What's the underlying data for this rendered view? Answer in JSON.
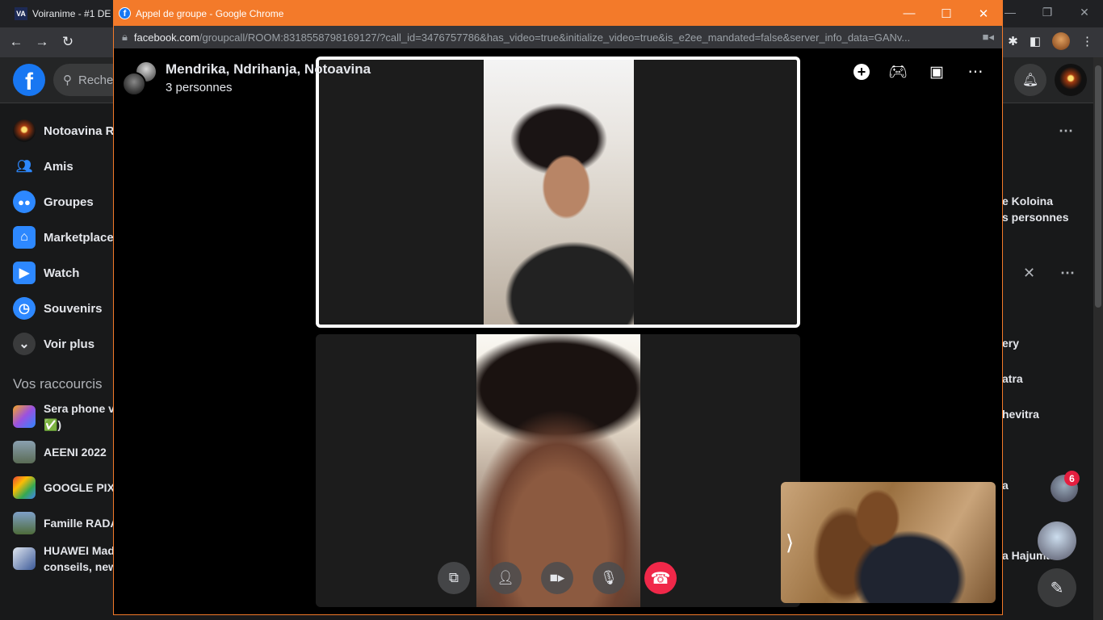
{
  "background_browser": {
    "tab_title": "Voiranime - #1 DE",
    "tab_icon_text": "VA"
  },
  "facebook": {
    "search_placeholder": "Reche",
    "left_nav": [
      {
        "label": "Notoavina Ra",
        "icon": "avatar-icon"
      },
      {
        "label": "Amis",
        "icon": "friends-icon"
      },
      {
        "label": "Groupes",
        "icon": "groups-icon"
      },
      {
        "label": "Marketplace",
        "icon": "marketplace-icon"
      },
      {
        "label": "Watch",
        "icon": "watch-icon"
      },
      {
        "label": "Souvenirs",
        "icon": "memories-icon"
      },
      {
        "label": "Voir plus",
        "icon": "chevron-down-icon"
      }
    ],
    "shortcuts_title": "Vos raccourcis",
    "shortcuts": [
      {
        "label": "Sera phone v\n✅)"
      },
      {
        "label": "AEENI 2022"
      },
      {
        "label": "GOOGLE PIX"
      },
      {
        "label": "Famille RADA"
      },
      {
        "label": "HUAWEI Mad\nconseils, new"
      }
    ],
    "right_panel": {
      "group_line1": "e Koloina",
      "group_line2": "s personnes",
      "contact1": "ery",
      "contact2": "atra",
      "contact3": "hevitra",
      "contact4": "a",
      "contact5": "a Hajuma",
      "badge_count": "6"
    }
  },
  "popup": {
    "window_title": "Appel de groupe - Google Chrome",
    "url_domain": "facebook.com",
    "url_rest": "/groupcall/ROOM:8318558798169127/?call_id=3476757786&has_video=true&initialize_video=true&is_e2ee_mandated=false&server_info_data=GANv...",
    "call": {
      "participants": "Mendrika, Ndrihanja, Notoavina",
      "count_label": "3 personnes"
    }
  },
  "colors": {
    "popup_titlebar": "#f37a2a",
    "facebook_blue": "#1877f2",
    "end_call_red": "#f02849",
    "background": "#18191a"
  }
}
